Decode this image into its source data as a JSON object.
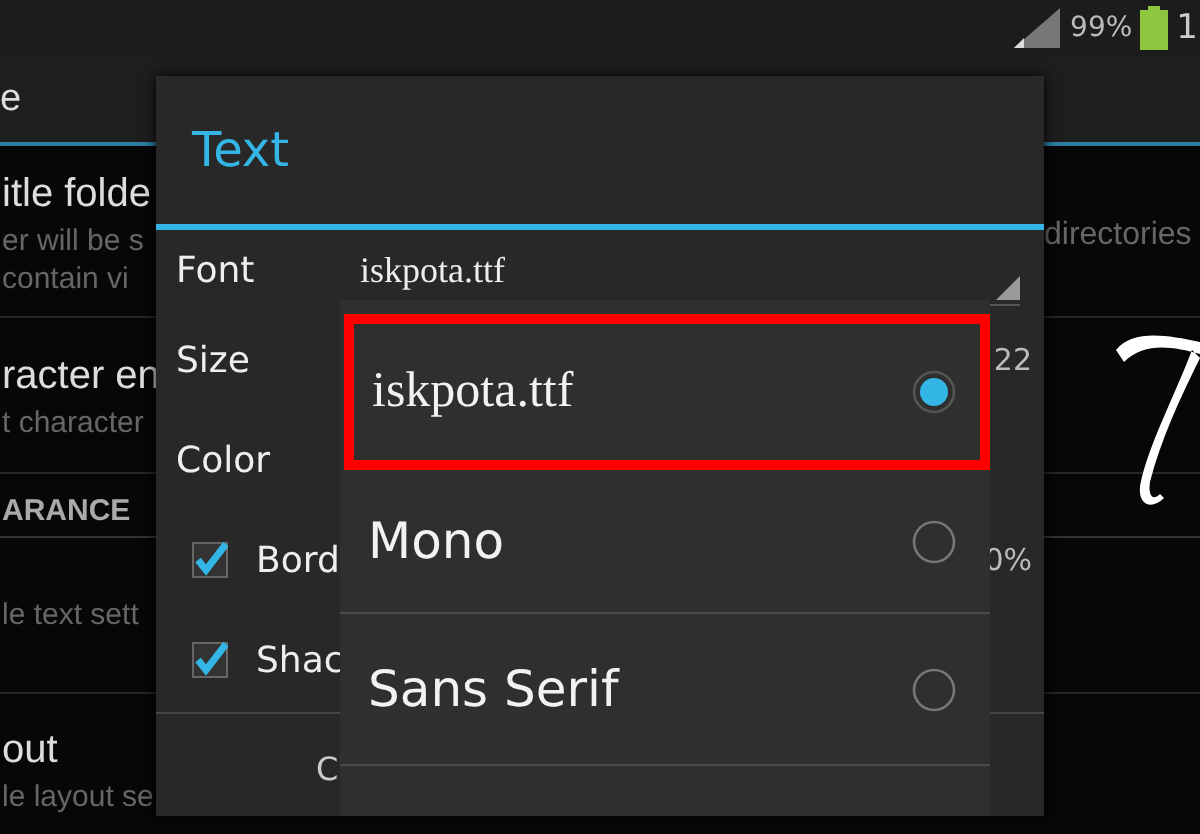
{
  "status_bar": {
    "battery": "99%",
    "time": "1"
  },
  "settings": {
    "title": "e",
    "rows": [
      {
        "kind": "item",
        "title": "itle folde",
        "summary": [
          "er will be s",
          "contain vi"
        ],
        "right": "directories"
      },
      {
        "kind": "item",
        "title": "racter en",
        "summary": [
          "t character"
        ],
        "right": ""
      },
      {
        "kind": "header",
        "title": "ARANCE"
      },
      {
        "kind": "item",
        "title": "",
        "summary": [
          "le text sett"
        ]
      },
      {
        "kind": "item",
        "title": "out",
        "summary": [
          "le layout se"
        ]
      }
    ]
  },
  "dialog": {
    "title": "Text",
    "font": {
      "label": "Font",
      "value": "iskpota.ttf"
    },
    "size": {
      "label": "Size",
      "value": "22"
    },
    "color": {
      "label": "Color"
    },
    "checkboxes": [
      {
        "label": "Bord",
        "checked": true,
        "value": "0%"
      },
      {
        "label": "Shac",
        "checked": true
      }
    ],
    "button": "C"
  },
  "popup": {
    "options": [
      {
        "label": "iskpota.ttf",
        "kind": "serif",
        "selected": true,
        "highlighted": true
      },
      {
        "label": "Mono",
        "kind": "sans",
        "selected": false,
        "highlighted": false
      },
      {
        "label": "Sans Serif",
        "kind": "sans",
        "selected": false,
        "highlighted": false
      }
    ]
  }
}
